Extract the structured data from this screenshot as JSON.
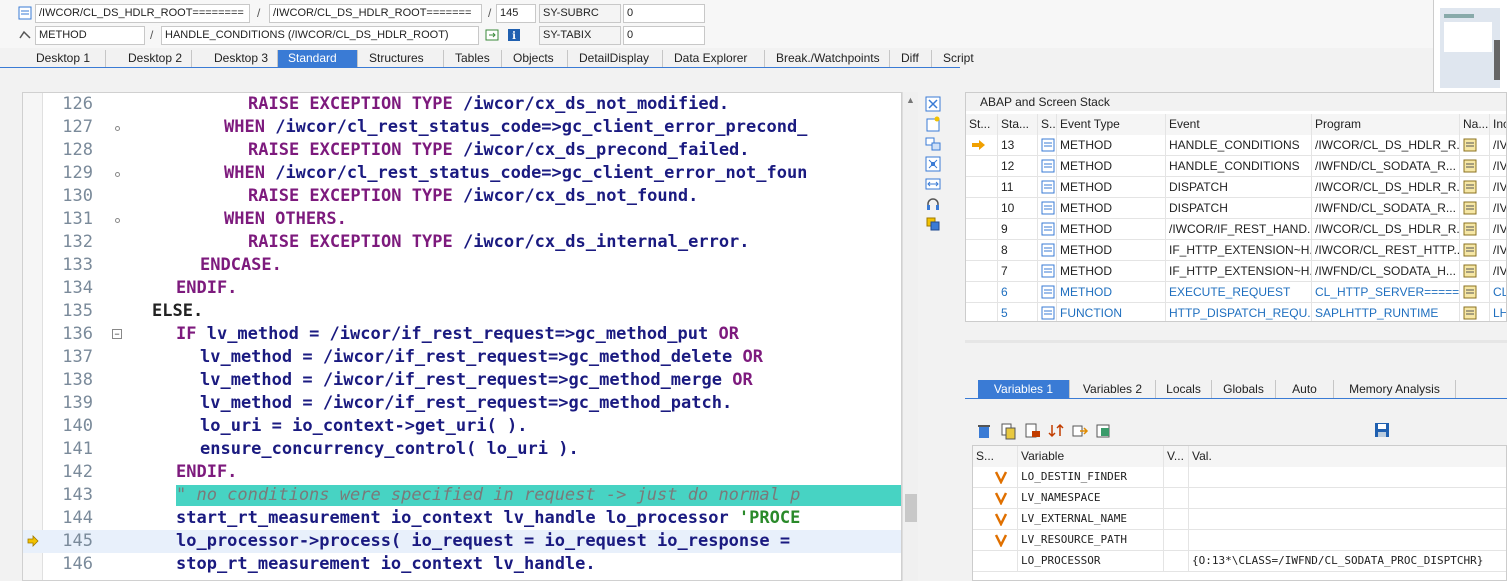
{
  "header": {
    "row1": {
      "program1": "/IWCOR/CL_DS_HDLR_ROOT========",
      "program2": "/IWCOR/CL_DS_HDLR_ROOT=======",
      "line": "145",
      "field": "SY-SUBRC",
      "value": "0"
    },
    "row2": {
      "type": "METHOD",
      "method": "HANDLE_CONDITIONS (/IWCOR/CL_DS_HDLR_ROOT)",
      "field": "SY-TABIX",
      "value": "0"
    }
  },
  "tabs": [
    "Desktop 1",
    "Desktop 2",
    "Desktop 3",
    "Standard",
    "Structures",
    "Tables",
    "Objects",
    "DetailDisplay",
    "Data Explorer",
    "Break./Watchpoints",
    "Diff",
    "Script"
  ],
  "active_tab": "Standard",
  "code": [
    {
      "n": "126",
      "text": "        RAISE EXCEPTION TYPE /iwcor/cx_ds_not_modified."
    },
    {
      "n": "127",
      "text": "      WHEN /iwcor/cl_rest_status_code=>gc_client_error_precond_"
    },
    {
      "n": "128",
      "text": "        RAISE EXCEPTION TYPE /iwcor/cx_ds_precond_failed."
    },
    {
      "n": "129",
      "text": "      WHEN /iwcor/cl_rest_status_code=>gc_client_error_not_foun"
    },
    {
      "n": "130",
      "text": "        RAISE EXCEPTION TYPE /iwcor/cx_ds_not_found."
    },
    {
      "n": "131",
      "text": "      WHEN OTHERS."
    },
    {
      "n": "132",
      "text": "        RAISE EXCEPTION TYPE /iwcor/cx_ds_internal_error."
    },
    {
      "n": "133",
      "text": "    ENDCASE."
    },
    {
      "n": "134",
      "text": "  ENDIF."
    },
    {
      "n": "135",
      "text": "ELSE."
    },
    {
      "n": "136",
      "text": "  IF lv_method = /iwcor/if_rest_request=>gc_method_put OR"
    },
    {
      "n": "137",
      "text": "    lv_method = /iwcor/if_rest_request=>gc_method_delete OR"
    },
    {
      "n": "138",
      "text": "    lv_method = /iwcor/if_rest_request=>gc_method_merge OR"
    },
    {
      "n": "139",
      "text": "    lv_method = /iwcor/if_rest_request=>gc_method_patch."
    },
    {
      "n": "140",
      "text": "    lo_uri = io_context->get_uri( )."
    },
    {
      "n": "141",
      "text": "    ensure_concurrency_control( lo_uri )."
    },
    {
      "n": "142",
      "text": "  ENDIF."
    },
    {
      "n": "143",
      "text": "  \" no conditions were specified in request -> just do normal p"
    },
    {
      "n": "144",
      "text": "  start_rt_measurement io_context lv_handle lo_processor 'PROCE"
    },
    {
      "n": "145",
      "text": "lo_processor->process( io_request = io_request io_response ="
    },
    {
      "n": "146",
      "text": "  stop_rt_measurement io_context lv_handle."
    }
  ],
  "stack": {
    "title": "ABAP and Screen Stack",
    "headers": [
      "St...",
      "Sta...",
      "S...",
      "Event Type",
      "Event",
      "Program",
      "Na...",
      "Inc"
    ],
    "rows": [
      {
        "level": "13",
        "type": "METHOD",
        "event": "HANDLE_CONDITIONS",
        "program": "/IWCOR/CL_DS_HDLR_R...",
        "inc": "/IV"
      },
      {
        "level": "12",
        "type": "METHOD",
        "event": "HANDLE_CONDITIONS",
        "program": "/IWFND/CL_SODATA_R...",
        "inc": "/IV"
      },
      {
        "level": "11",
        "type": "METHOD",
        "event": "DISPATCH",
        "program": "/IWCOR/CL_DS_HDLR_R...",
        "inc": "/IV"
      },
      {
        "level": "10",
        "type": "METHOD",
        "event": "DISPATCH",
        "program": "/IWFND/CL_SODATA_R...",
        "inc": "/IV"
      },
      {
        "level": "9",
        "type": "METHOD",
        "event": "/IWCOR/IF_REST_HAND...",
        "program": "/IWCOR/CL_DS_HDLR_R...",
        "inc": "/IV"
      },
      {
        "level": "8",
        "type": "METHOD",
        "event": "IF_HTTP_EXTENSION~H...",
        "program": "/IWCOR/CL_REST_HTTP...",
        "inc": "/IV"
      },
      {
        "level": "7",
        "type": "METHOD",
        "event": "IF_HTTP_EXTENSION~H...",
        "program": "/IWFND/CL_SODATA_H...",
        "inc": "/IV"
      },
      {
        "level": "6",
        "type": "METHOD",
        "event": "EXECUTE_REQUEST",
        "program": "CL_HTTP_SERVER=====...",
        "inc": "CL_"
      },
      {
        "level": "5",
        "type": "FUNCTION",
        "event": "HTTP_DISPATCH_REQU...",
        "program": "SAPLHTTP_RUNTIME",
        "inc": "LHT"
      }
    ]
  },
  "var_tabs": [
    "Variables 1",
    "Variables 2",
    "Locals",
    "Globals",
    "Auto",
    "Memory Analysis"
  ],
  "active_var_tab": "Variables 1",
  "vars": {
    "headers": [
      "S...",
      "Variable",
      "V...",
      "Val."
    ],
    "rows": [
      {
        "name": "LO_DESTIN_FINDER",
        "value": ""
      },
      {
        "name": "LV_NAMESPACE",
        "value": ""
      },
      {
        "name": "LV_EXTERNAL_NAME",
        "value": ""
      },
      {
        "name": "LV_RESOURCE_PATH",
        "value": ""
      },
      {
        "name": "LO_PROCESSOR",
        "value": "{O:13*\\CLASS=/IWFND/CL_SODATA_PROC_DISPTCHR}"
      }
    ]
  },
  "colors": {
    "accent": "#3a7bd5",
    "keyword": "#7d1a7d",
    "comment_bg": "#47d3c3"
  }
}
